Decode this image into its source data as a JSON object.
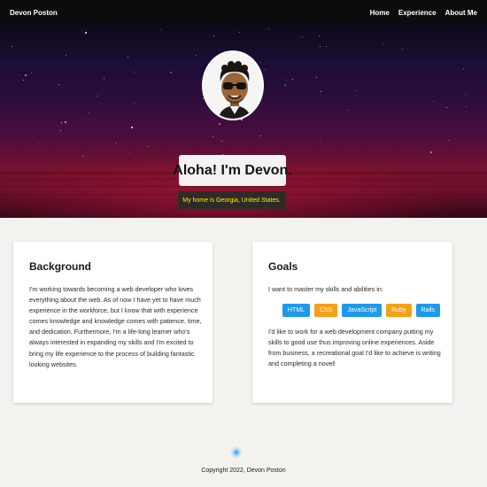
{
  "navbar": {
    "brand": "Devon Poston",
    "links": [
      "Home",
      "Experience",
      "About Me"
    ]
  },
  "hero": {
    "avatar": "avatar",
    "title": "Aloha! I'm Devon.",
    "subtitle": "My home is Georgia, United States."
  },
  "background": {
    "title": "Background",
    "text": "I'm working towards becoming a web developer who loves everything about the web. As of now I have yet to have much experience in the workforce, but I know that with experience comes knowledge and knowledge comes with patience, time, and dedication. Furthermore, I'm a life-long learner who's always interested in expanding my skills and I'm excited to bring my life experience to the process of building fantastic looking websites."
  },
  "goals": {
    "title": "Goals",
    "intro": "I want to master my skills and abilities in:",
    "skills": [
      {
        "label": "HTML",
        "color": "#1f9aea"
      },
      {
        "label": "CSS",
        "color": "#f4a11a"
      },
      {
        "label": "JavaScript",
        "color": "#1f9aea"
      },
      {
        "label": "Ruby",
        "color": "#f4a11a"
      },
      {
        "label": "Rails",
        "color": "#1f9aea"
      }
    ],
    "text": "I'd like to work for a web development company putting my skills to good use thus improving online experiences. Aside from business, a recreational goal I'd like to achieve is writing and completing a novel!"
  },
  "footer": {
    "icon": "circle-logo-icon",
    "copyright": "Copyright 2022, Devon Poston"
  },
  "colors": {
    "navbar_bg": "#0c0c0e",
    "subtitle_text": "#ffe81a",
    "badge_blue": "#1f9aea",
    "badge_orange": "#f4a11a",
    "page_bg": "#f4f2ee"
  }
}
